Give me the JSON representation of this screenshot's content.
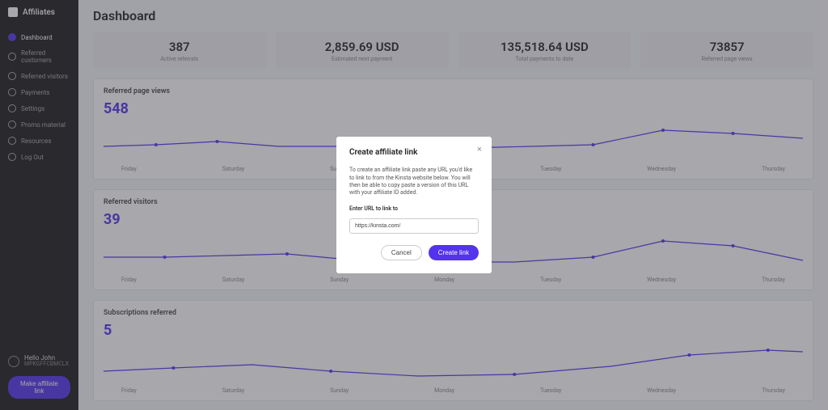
{
  "brand": "Affiliates",
  "sidebar": {
    "items": [
      {
        "label": "Dashboard"
      },
      {
        "label": "Referred customers"
      },
      {
        "label": "Referred visitors"
      },
      {
        "label": "Payments"
      },
      {
        "label": "Settings"
      },
      {
        "label": "Promo material"
      },
      {
        "label": "Resources"
      },
      {
        "label": "Log Out"
      }
    ]
  },
  "user": {
    "greeting": "Hello John",
    "code": "MPKGFFCBMCLX"
  },
  "make_link_label": "Make affiliate link",
  "page_title": "Dashboard",
  "stats": [
    {
      "value": "387",
      "label": "Active referrals"
    },
    {
      "value": "2,859.69 USD",
      "label": "Estimated next payment"
    },
    {
      "value": "135,518.64 USD",
      "label": "Total payments to date"
    },
    {
      "value": "73857",
      "label": "Referred page views"
    }
  ],
  "charts": [
    {
      "title": "Referred page views",
      "big": "548"
    },
    {
      "title": "Referred visitors",
      "big": "39"
    },
    {
      "title": "Subscriptions referred",
      "big": "5"
    }
  ],
  "axis": [
    "Friday",
    "Saturday",
    "Sunday",
    "Monday",
    "Tuesday",
    "Wednesday",
    "Thursday"
  ],
  "modal": {
    "title": "Create affiliate link",
    "desc": "To create an affiliate link paste any URL you'd like to link to from the Kinsta website below. You will then be able to copy paste a version of this URL with your affiliate ID added.",
    "label": "Enter URL to link to",
    "value": "https://kinsta.com/",
    "cancel": "Cancel",
    "create": "Create link"
  },
  "chart_data": [
    {
      "type": "line",
      "title": "Referred page views",
      "categories": [
        "Friday",
        "Saturday",
        "Sunday",
        "Monday",
        "Tuesday",
        "Wednesday",
        "Thursday"
      ],
      "values": [
        540,
        560,
        540,
        535,
        550,
        600,
        570
      ],
      "big_value": 548,
      "xlabel": "",
      "ylabel": "",
      "ylim": [
        500,
        620
      ]
    },
    {
      "type": "line",
      "title": "Referred visitors",
      "categories": [
        "Friday",
        "Saturday",
        "Sunday",
        "Monday",
        "Tuesday",
        "Wednesday",
        "Thursday"
      ],
      "values": [
        42,
        43,
        39,
        35,
        40,
        52,
        41
      ],
      "big_value": 39,
      "xlabel": "",
      "ylabel": "",
      "ylim": [
        30,
        55
      ]
    },
    {
      "type": "line",
      "title": "Subscriptions referred",
      "categories": [
        "Friday",
        "Saturday",
        "Sunday",
        "Monday",
        "Tuesday",
        "Wednesday",
        "Thursday"
      ],
      "values": [
        5,
        6,
        4,
        3,
        4,
        7,
        8
      ],
      "big_value": 5,
      "xlabel": "",
      "ylabel": "",
      "ylim": [
        0,
        10
      ]
    }
  ]
}
